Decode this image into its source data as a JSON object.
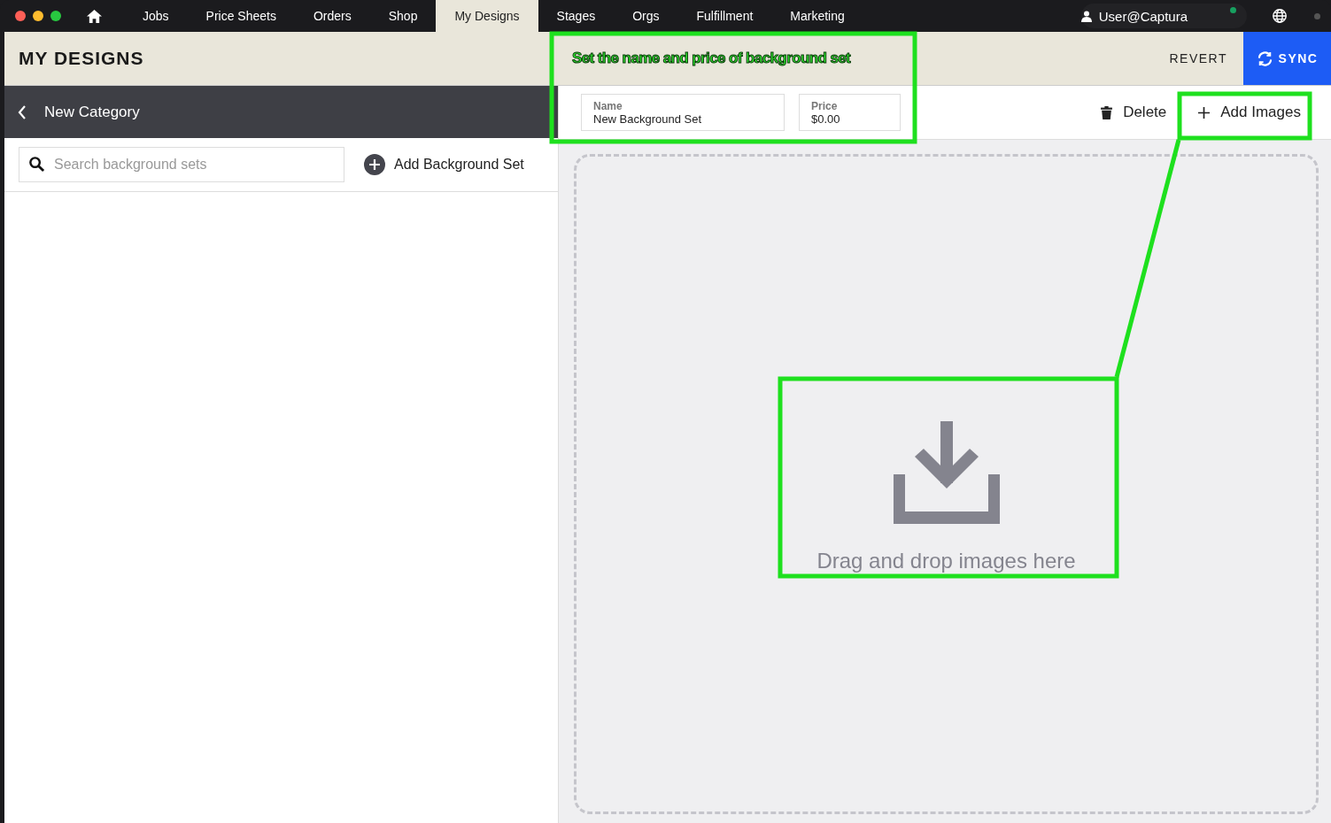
{
  "nav": {
    "tabs": [
      {
        "label": "Jobs",
        "selected": false
      },
      {
        "label": "Price Sheets",
        "selected": false
      },
      {
        "label": "Orders",
        "selected": false
      },
      {
        "label": "Shop",
        "selected": false
      },
      {
        "label": "My Designs",
        "selected": true
      },
      {
        "label": "Stages",
        "selected": false
      },
      {
        "label": "Orgs",
        "selected": false
      },
      {
        "label": "Fulfillment",
        "selected": false
      },
      {
        "label": "Marketing",
        "selected": false
      }
    ],
    "user": "User@Captura"
  },
  "header": {
    "title": "MY DESIGNS",
    "annotation": "Set the name and price of background set",
    "revert": "REVERT",
    "sync": "SYNC"
  },
  "sidebar": {
    "back_label": "New Category",
    "search": {
      "placeholder": "Search background sets"
    },
    "add_button": "Add Background Set"
  },
  "editor": {
    "name_field": {
      "label": "Name",
      "value": "New Background Set"
    },
    "price_field": {
      "label": "Price",
      "value": "$0.00"
    },
    "delete_button": "Delete",
    "add_images_button": "Add Images",
    "drop_zone_text": "Drag and drop images here"
  }
}
